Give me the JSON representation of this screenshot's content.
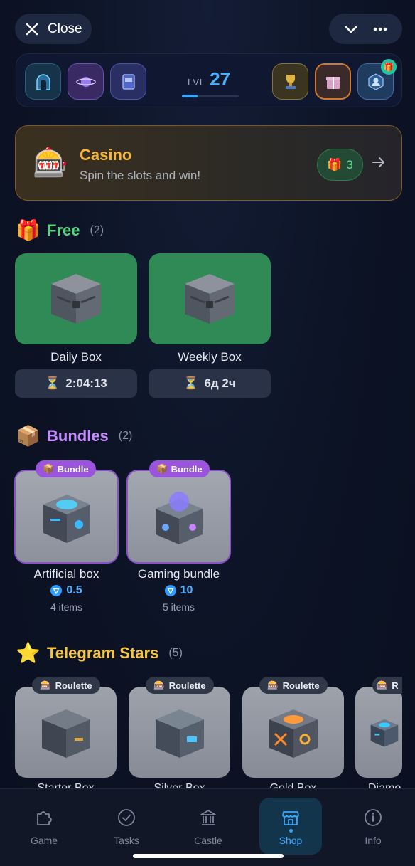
{
  "header": {
    "close_label": "Close"
  },
  "stats": {
    "level_label": "LVL",
    "level_value": "27",
    "level_progress": 0.28
  },
  "casino": {
    "title": "Casino",
    "subtitle": "Spin the slots and win!",
    "count": "3"
  },
  "free": {
    "title": "Free",
    "count": "(2)",
    "items": [
      {
        "name": "Daily Box",
        "timer": "2:04:13"
      },
      {
        "name": "Weekly Box",
        "timer": "6д 2ч"
      }
    ]
  },
  "bundles": {
    "title": "Bundles",
    "count": "(2)",
    "tag": "Bundle",
    "items": [
      {
        "name": "Artificial box",
        "price": "0.5",
        "items": "4 items"
      },
      {
        "name": "Gaming bundle",
        "price": "10",
        "items": "5 items"
      }
    ]
  },
  "stars": {
    "title": "Telegram Stars",
    "count": "(5)",
    "tag": "Roulette",
    "tag_short": "R",
    "items": [
      {
        "name": "Starter Box"
      },
      {
        "name": "Silver Box"
      },
      {
        "name": "Gold Box"
      },
      {
        "name": "Diamo"
      }
    ]
  },
  "nav": {
    "items": [
      {
        "label": "Game"
      },
      {
        "label": "Tasks"
      },
      {
        "label": "Castle"
      },
      {
        "label": "Shop"
      },
      {
        "label": "Info"
      }
    ]
  },
  "colors": {
    "accent": "#3aa7ff",
    "casino_gold": "#f5b63a",
    "free_green": "#2f8a55",
    "bundle_purple": "#9a55dc"
  }
}
